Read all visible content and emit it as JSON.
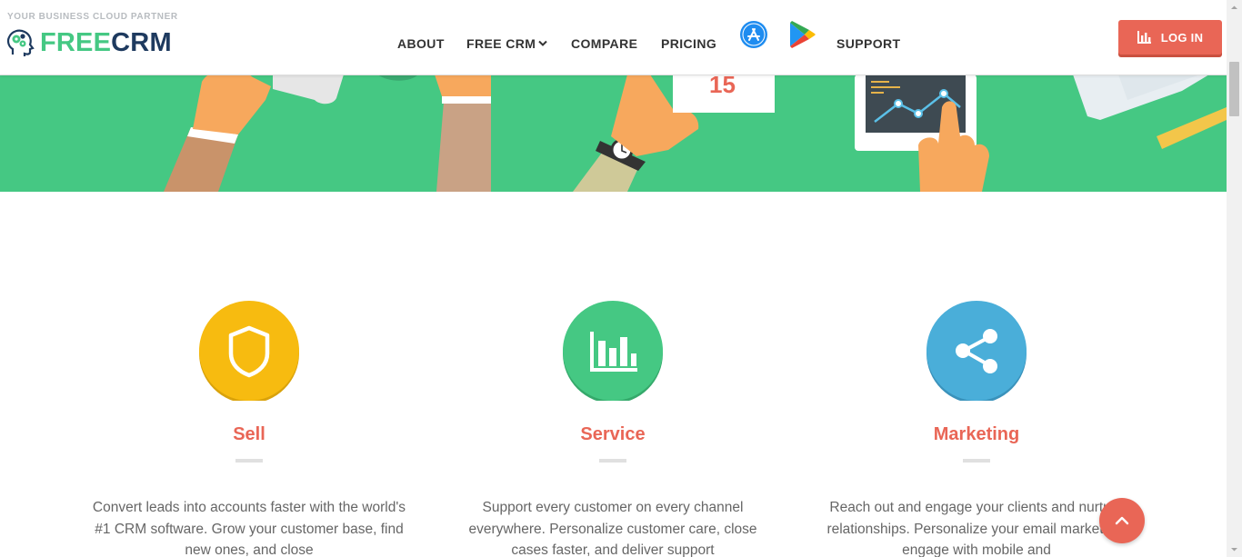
{
  "header": {
    "tagline": "YOUR BUSINESS CLOUD PARTNER",
    "logo_free": "FREE",
    "logo_crm": "CRM",
    "logo_icon": "head-gears-icon",
    "nav": [
      {
        "label": "ABOUT",
        "has_dropdown": false
      },
      {
        "label": "FREE CRM",
        "has_dropdown": true
      },
      {
        "label": "COMPARE",
        "has_dropdown": false
      },
      {
        "label": "PRICING",
        "has_dropdown": false
      },
      {
        "label": "SUPPORT",
        "has_dropdown": false
      }
    ],
    "app_store_icon": "app-store-icon",
    "play_store_icon": "google-play-icon",
    "login_label": "LOG IN",
    "login_icon": "bar-chart-icon"
  },
  "hero": {
    "calendar_number": "15",
    "background_color": "#45c883"
  },
  "features": [
    {
      "icon": "shield-icon",
      "color": "#f7bb10",
      "title": "Sell",
      "description": "Convert leads into accounts faster with the world's #1 CRM software. Grow your customer base, find new ones, and close"
    },
    {
      "icon": "bar-chart-icon",
      "color": "#45c883",
      "title": "Service",
      "description": "Support every customer on every channel everywhere. Personalize customer care, close cases faster, and deliver support"
    },
    {
      "icon": "share-icon",
      "color": "#4aaed9",
      "title": "Marketing",
      "description": "Reach out and engage your clients and nurture relationships. Personalize your email marketing, engage with mobile and"
    }
  ],
  "colors": {
    "accent": "#e96656",
    "brand_green": "#45c883",
    "brand_navy": "#1e3a5f"
  },
  "scroll_to_top_icon": "chevron-up-icon"
}
